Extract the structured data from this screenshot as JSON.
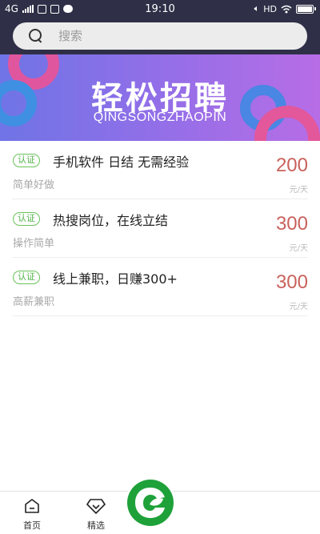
{
  "status_bar": {
    "network": "4G",
    "time": "19:10",
    "hd": "HD"
  },
  "search": {
    "placeholder": "搜索"
  },
  "banner": {
    "title": "轻松招聘",
    "subtitle": "QINGSONGZHAOPIN"
  },
  "jobs": [
    {
      "badge": "认证",
      "title": "手机软件 日结 无需经验",
      "desc": "简单好做",
      "price": "200",
      "unit": "元/天"
    },
    {
      "badge": "认证",
      "title": "热搜岗位，在线立结",
      "desc": "操作简单",
      "price": "300",
      "unit": "元/天"
    },
    {
      "badge": "认证",
      "title": "线上兼职，日赚300+",
      "desc": "高薪兼职",
      "price": "300",
      "unit": "元/天"
    }
  ],
  "nav": {
    "home_label": "首页",
    "featured_label": "精选"
  },
  "colors": {
    "header_bg": "#2f3047",
    "badge_green": "#52b348",
    "price_red": "#c9625d",
    "logo_green": "#1fa13a"
  }
}
